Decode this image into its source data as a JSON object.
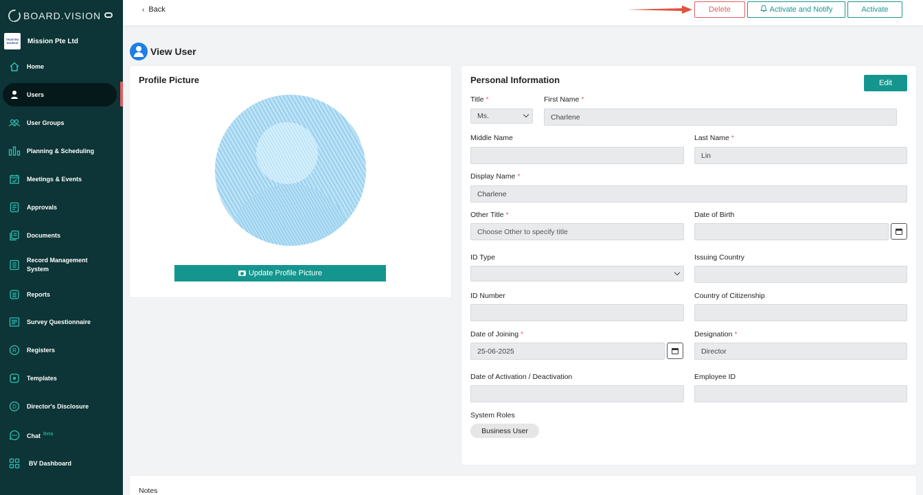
{
  "brand": {
    "name": "BOARD.VISION"
  },
  "org": {
    "name": "Mission Pte Ltd",
    "logo_text": "TRUSTED SOURCE"
  },
  "sidebar": {
    "items": [
      {
        "label": "Home",
        "icon": "home-icon"
      },
      {
        "label": "Users",
        "icon": "user-icon"
      },
      {
        "label": "User Groups",
        "icon": "user-groups-icon"
      },
      {
        "label": "Planning & Scheduling",
        "icon": "planning-icon"
      },
      {
        "label": "Meetings & Events",
        "icon": "calendar-check-icon"
      },
      {
        "label": "Approvals",
        "icon": "approvals-icon"
      },
      {
        "label": "Documents",
        "icon": "documents-icon"
      },
      {
        "label": "Record Management System",
        "icon": "records-icon"
      },
      {
        "label": "Reports",
        "icon": "reports-icon"
      },
      {
        "label": "Survey Questionnaire",
        "icon": "survey-icon"
      },
      {
        "label": "Registers",
        "icon": "registers-icon"
      },
      {
        "label": "Templates",
        "icon": "templates-icon"
      },
      {
        "label": "Director's Disclosure",
        "icon": "disclosure-icon"
      },
      {
        "label": "Chat",
        "icon": "chat-icon",
        "badge": "Beta"
      },
      {
        "label": "BV Dashboard",
        "icon": "dashboard-icon"
      }
    ],
    "active_index": 1
  },
  "topbar": {
    "back_label": "Back",
    "delete_label": "Delete",
    "notify_label": "Activate and Notify",
    "activate_label": "Activate"
  },
  "page": {
    "title": "View User"
  },
  "profile": {
    "title": "Profile Picture",
    "update_label": "Update Profile Picture"
  },
  "personal": {
    "title": "Personal Information",
    "edit_label": "Edit",
    "title_label": "Title",
    "title_value": "Ms.",
    "first_name_label": "First Name",
    "first_name_value": "Charlene",
    "middle_name_label": "Middle Name",
    "middle_name_value": "",
    "last_name_label": "Last Name",
    "last_name_value": "Lin",
    "display_name_label": "Display Name",
    "display_name_value": "Charlene",
    "other_title_label": "Other Title",
    "other_title_placeholder": "Choose Other to specify title",
    "dob_label": "Date of Birth",
    "dob_value": "",
    "id_type_label": "ID Type",
    "id_type_value": "",
    "issuing_country_label": "Issuing Country",
    "issuing_country_value": "",
    "id_number_label": "ID Number",
    "id_number_value": "",
    "citizenship_label": "Country of Citizenship",
    "citizenship_value": "",
    "joining_label": "Date of Joining",
    "joining_value": "25-06-2025",
    "designation_label": "Designation",
    "designation_value": "Director",
    "activation_label": "Date of Activation / Deactivation",
    "activation_value": "",
    "employee_id_label": "Employee ID",
    "employee_id_value": "",
    "roles_label": "System Roles",
    "roles": [
      "Business User"
    ],
    "required_mark": "*"
  },
  "notes": {
    "label": "Notes"
  },
  "colors": {
    "sidebar_bg": "#0d3436",
    "accent": "#14968f",
    "danger": "#e35d5d",
    "title_icon": "#1e7ee6"
  }
}
